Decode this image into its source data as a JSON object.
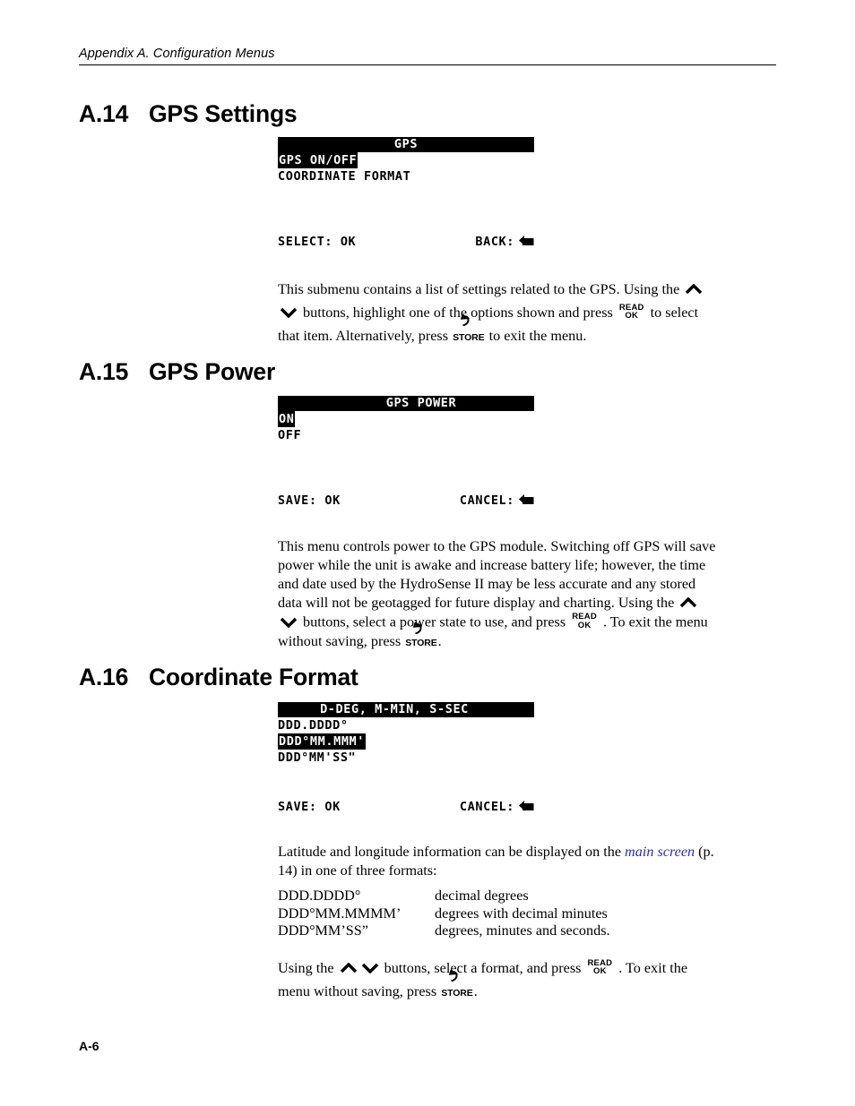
{
  "header": {
    "running_head": "Appendix A.  Configuration Menus"
  },
  "sections": [
    {
      "number": "A.14",
      "title": "GPS Settings",
      "screen": {
        "title": "GPS",
        "rows": [
          {
            "text": "GPS ON/OFF",
            "selected": true
          },
          {
            "text": "COORDINATE FORMAT",
            "selected": false
          }
        ],
        "footer_left": "SELECT: OK",
        "footer_right": "BACK:",
        "footer_right_icon": "back-arrow-icon"
      },
      "body": {
        "p1a": "This submenu contains a list of settings related to the GPS.  Using the ",
        "p1b": " buttons, highlight one of the options shown and press ",
        "p1c": " to select that item. Alternatively, press ",
        "p1d": " to exit the menu."
      }
    },
    {
      "number": "A.15",
      "title": "GPS Power",
      "screen": {
        "title": "GPS POWER",
        "rows": [
          {
            "text": "ON",
            "selected": true
          },
          {
            "text": "OFF",
            "selected": false
          }
        ],
        "footer_left": "SAVE: OK",
        "footer_right": "CANCEL:",
        "footer_right_icon": "back-arrow-icon"
      },
      "body": {
        "p1a": "This menu controls power to the GPS module.  Switching off GPS will save power while the unit is awake and increase battery life; however, the time and date used by the HydroSense II may be less accurate and any stored data will not be geotagged for future display and charting.  Using the ",
        "p1b": " buttons, select a power state to use, and press ",
        "p1c": " .  To exit the menu without saving, press ",
        "p1d": "."
      }
    },
    {
      "number": "A.16",
      "title": "Coordinate Format",
      "screen": {
        "title": "D-DEG, M-MIN, S-SEC",
        "rows": [
          {
            "text": "DDD.DDDD°",
            "selected": false
          },
          {
            "text": "DDD°MM.MMM'",
            "selected": true
          },
          {
            "text": "DDD°MM'SS\"",
            "selected": false
          }
        ],
        "footer_left": "SAVE: OK",
        "footer_right": "CANCEL:",
        "footer_right_icon": "back-arrow-icon"
      },
      "body": {
        "p1a": "Latitude and longitude information can be displayed on the ",
        "p1_link": "main screen",
        "p1b": " (p. 14) in one of three formats:",
        "p2a": "Using the ",
        "p2b": " buttons, select a format, and press ",
        "p2c": " .  To exit the menu without saving, press ",
        "p2d": "."
      },
      "formats": [
        {
          "term": "DDD.DDDD°",
          "definition": "decimal degrees"
        },
        {
          "term": "DDD°MM.MMMM’",
          "definition": "degrees with decimal minutes"
        },
        {
          "term": "DDD°MM’SS”",
          "definition": "degrees, minutes and seconds."
        }
      ]
    }
  ],
  "buttons": {
    "read_ok_line1": "READ",
    "read_ok_line2": "OK",
    "store_label": "STORE",
    "up_icon": "chevron-up-icon",
    "down_icon": "chevron-down-icon"
  },
  "footer": {
    "page_number": "A-6"
  },
  "colors": {
    "text": "#000000",
    "link": "#2a2ac0",
    "lcd_background": "#ffffff",
    "lcd_highlight": "#000000"
  }
}
